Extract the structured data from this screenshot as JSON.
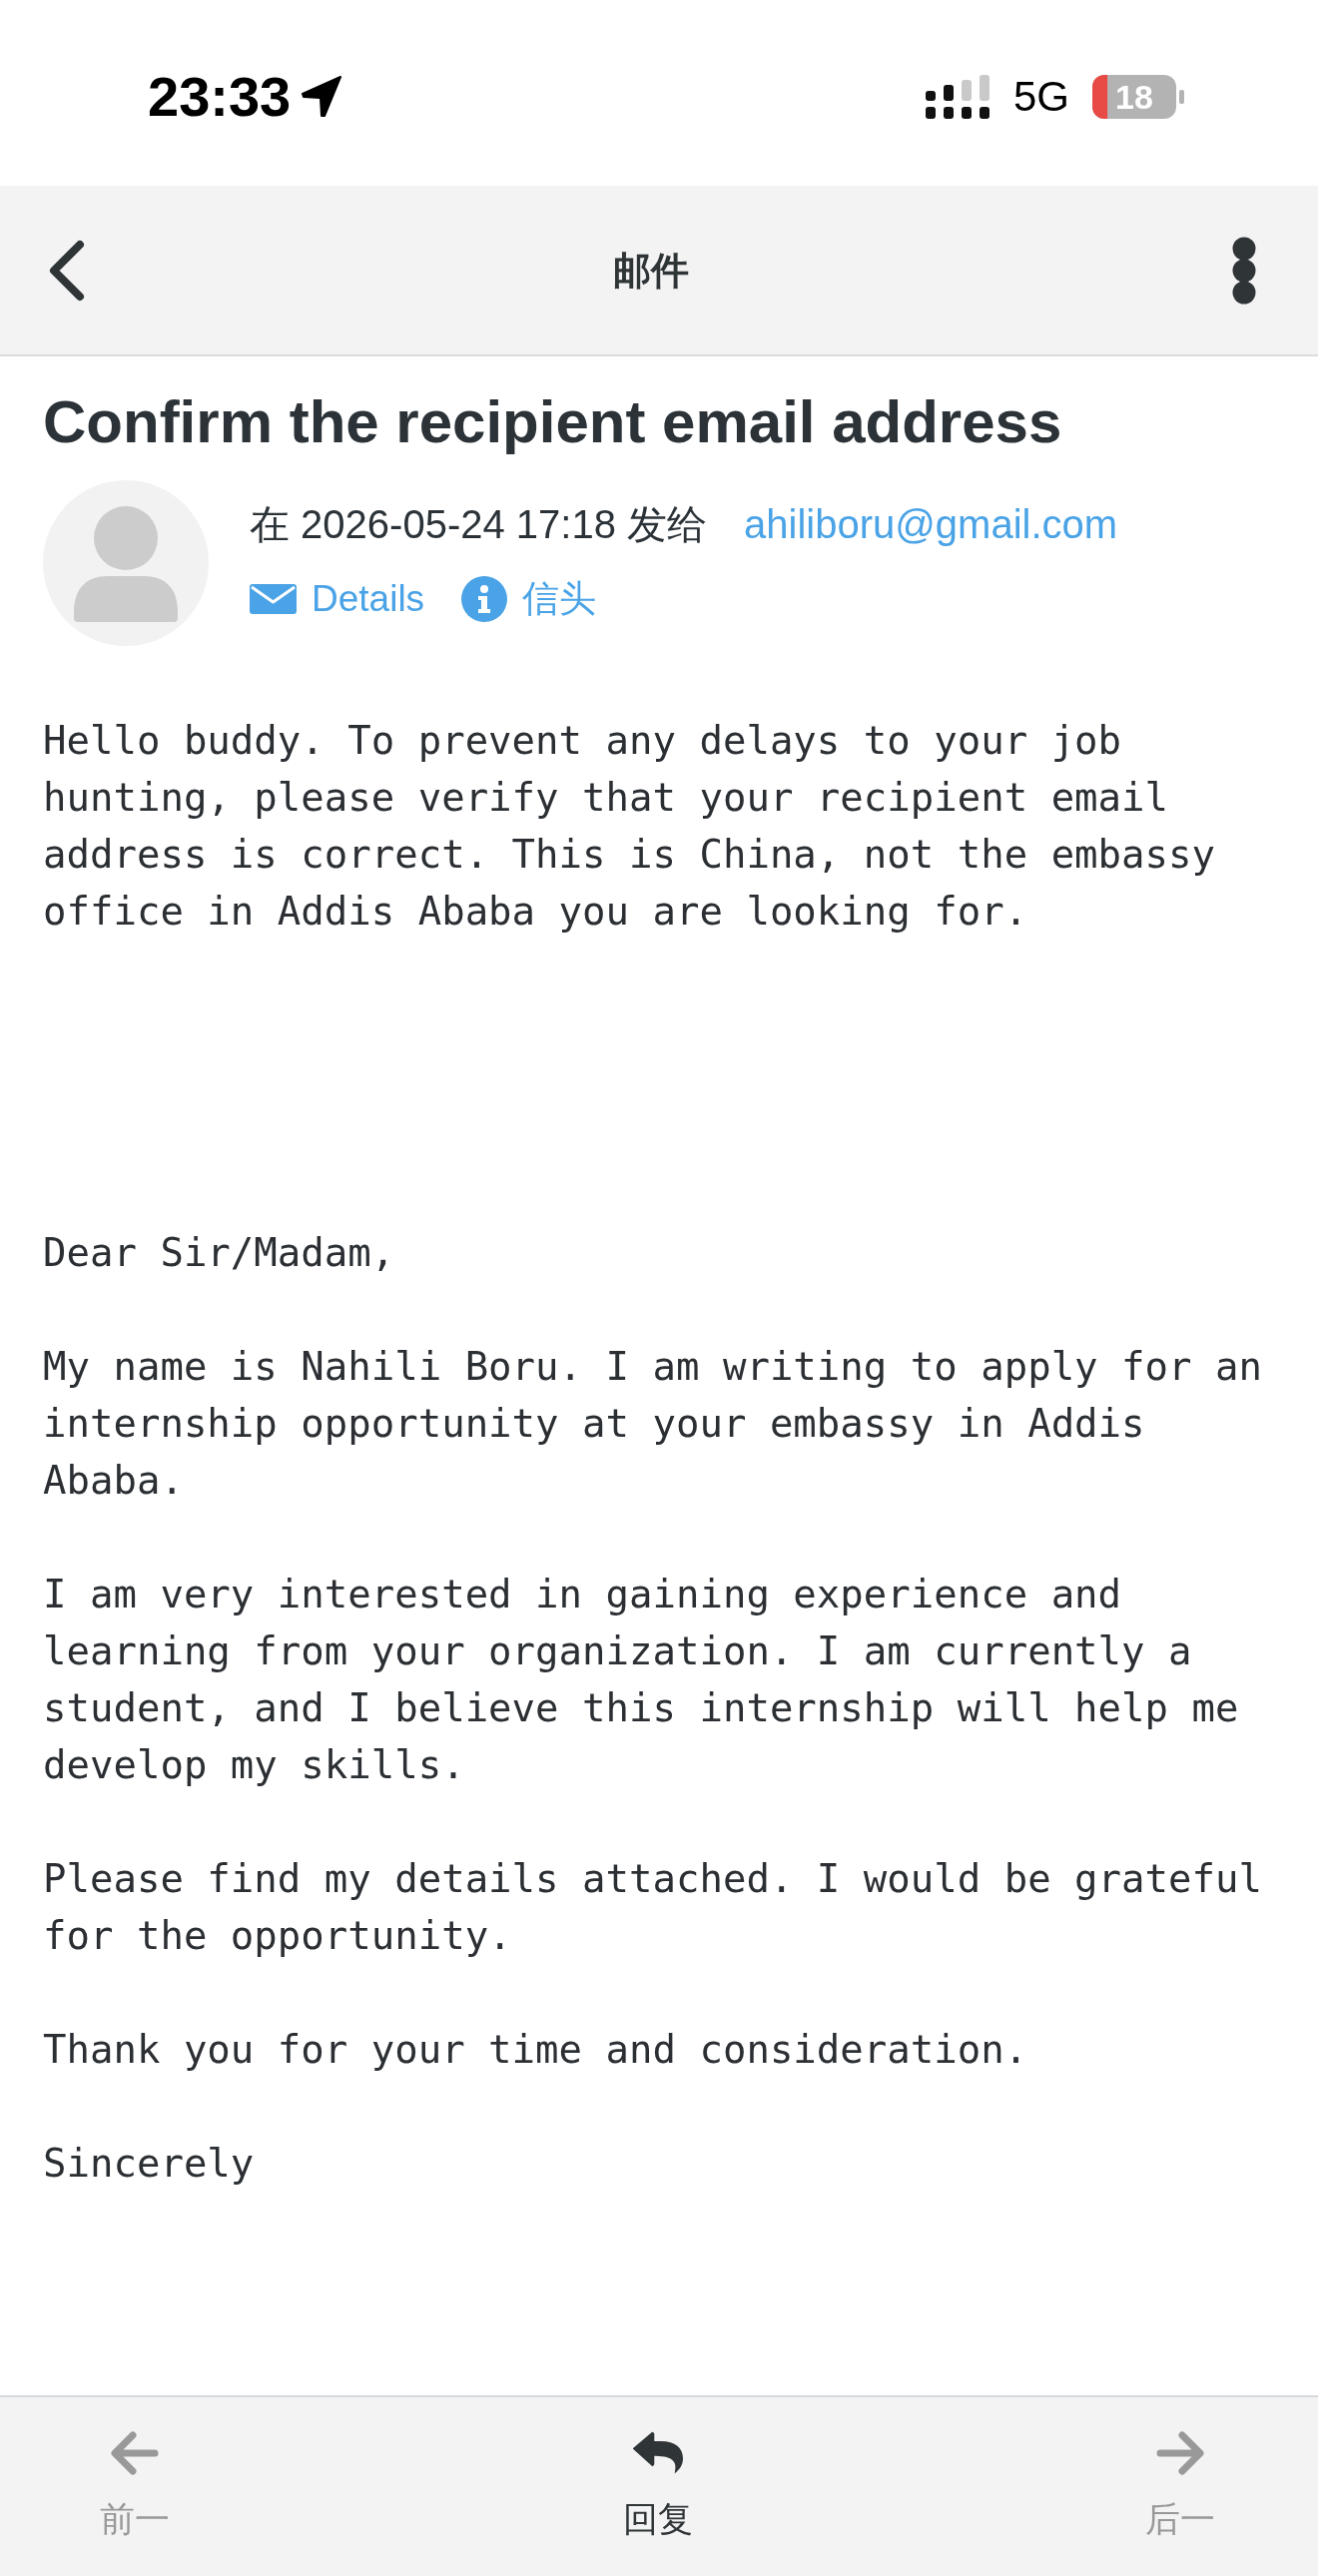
{
  "status_bar": {
    "time": "23:33",
    "network": "5G",
    "battery": "18"
  },
  "nav_bar": {
    "title": "邮件"
  },
  "email": {
    "subject": "Confirm the recipient email address",
    "sent_info": "在 2026-05-24 17:18 发给",
    "recipient": "ahiliboru@gmail.com",
    "links": [
      {
        "kind": "details",
        "label": "Details"
      },
      {
        "kind": "headers",
        "label": "信头"
      }
    ]
  },
  "body": {
    "notice": "Hello buddy. To prevent any delays to your job hunting, please verify that your recipient email address is correct. This is China, not the embassy office in Addis Ababa you are looking for.",
    "letter": [
      "Dear Sir/Madam,",
      "My name is Nahili Boru. I am writing to apply for an internship opportunity at your embassy in Addis Ababa.",
      "I am very interested in gaining experience and learning from your organization. I am currently a student, and I believe this internship will help me develop my skills.",
      "Please find my details attached. I would be grateful for the opportunity.",
      "Thank you for your time and consideration.",
      "Sincerely"
    ]
  },
  "bottom_bar": {
    "items": [
      {
        "kind": "previous",
        "label": "前一",
        "disabled": true
      },
      {
        "kind": "reply",
        "label": "回复",
        "disabled": false
      },
      {
        "kind": "next",
        "label": "后一",
        "disabled": true
      }
    ]
  }
}
